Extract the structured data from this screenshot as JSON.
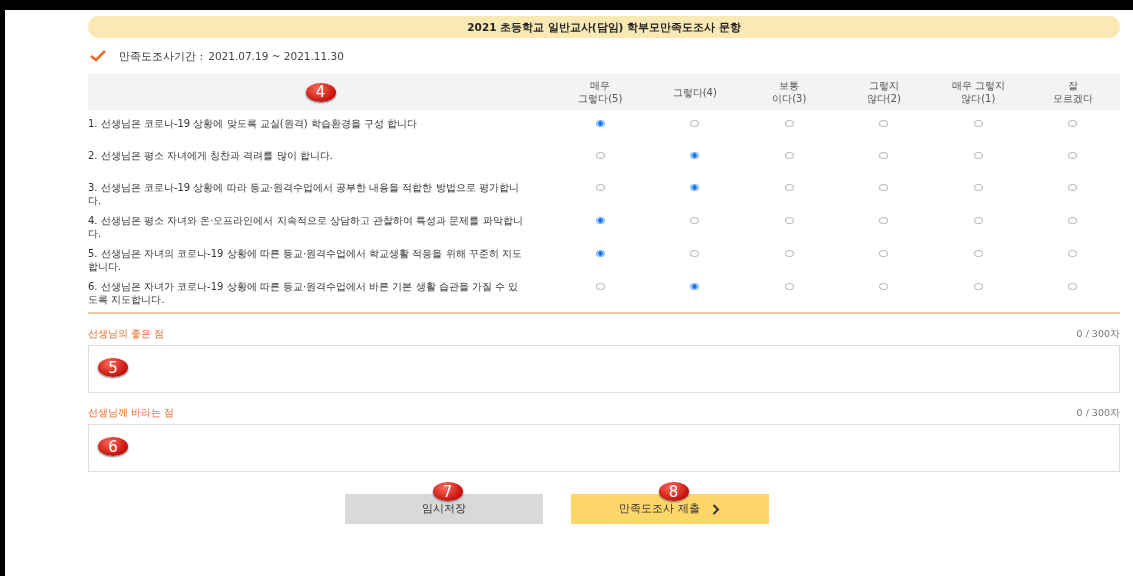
{
  "title": "2021 초등학교 일반교사(담임) 학부모만족도조사 문항",
  "period": {
    "label": "만족도조사기간 :",
    "value": "2021.07.19 ~ 2021.11.30"
  },
  "table": {
    "callout": "4",
    "columns": [
      "매우\n그렇다(5)",
      "그렇다(4)",
      "보통\n이다(3)",
      "그렇지\n않다(2)",
      "매우 그렇지\n않다(1)",
      "잘\n모르겠다"
    ],
    "rows": [
      {
        "question": "1. 선생님은 코로나-19 상황에 맞도록 교실(원격) 학습환경을 구성 합니다",
        "options": [
          {
            "selected": true
          },
          {
            "selected": false
          },
          {
            "selected": false
          },
          {
            "selected": false
          },
          {
            "selected": false
          },
          {
            "selected": false
          }
        ]
      },
      {
        "question": "2. 선생님은 평소 자녀에게 칭찬과 격려를 많이 합니다.",
        "options": [
          {
            "selected": false
          },
          {
            "selected": true
          },
          {
            "selected": false
          },
          {
            "selected": false
          },
          {
            "selected": false
          },
          {
            "selected": false
          }
        ]
      },
      {
        "question": "3. 선생님은 코로나-19 상황에 따라 등교·원격수업에서 공부한 내용을 적합한 방법으로 평가합니다.",
        "options": [
          {
            "selected": false
          },
          {
            "selected": true
          },
          {
            "selected": false
          },
          {
            "selected": false
          },
          {
            "selected": false
          },
          {
            "selected": false
          }
        ]
      },
      {
        "question": "4. 선생님은 평소 자녀와 온·오프라인에서 지속적으로 상담하고 관찰하여 특성과 문제를 파악합니다.",
        "options": [
          {
            "selected": true
          },
          {
            "selected": false
          },
          {
            "selected": false
          },
          {
            "selected": false
          },
          {
            "selected": false
          },
          {
            "selected": false
          }
        ]
      },
      {
        "question": "5. 선생님은 자녀의 코로나-19 상황에 따른 등교·원격수업에서 학교생활 적응을 위해 꾸준히 지도합니다.",
        "options": [
          {
            "selected": true
          },
          {
            "selected": false
          },
          {
            "selected": false
          },
          {
            "selected": false
          },
          {
            "selected": false
          },
          {
            "selected": false
          }
        ]
      },
      {
        "question": "6. 선생님은 자녀가 코로나-19 상황에 따른 등교·원격수업에서 바른 기본 생활 습관을 가질 수 있도록 지도합니다.",
        "options": [
          {
            "selected": false
          },
          {
            "selected": true
          },
          {
            "selected": false
          },
          {
            "selected": false
          },
          {
            "selected": false
          },
          {
            "selected": false
          }
        ]
      }
    ]
  },
  "comments": [
    {
      "label": "선생님의 좋은 점",
      "counter": "0 / 300자",
      "callout": "5"
    },
    {
      "label": "선생님께 바라는 점",
      "counter": "0 / 300자",
      "callout": "6"
    }
  ],
  "buttons": [
    {
      "label": "임시저장",
      "kind": "save",
      "callout": "7"
    },
    {
      "label": "만족도조사 제출",
      "kind": "submit",
      "callout": "8"
    }
  ]
}
